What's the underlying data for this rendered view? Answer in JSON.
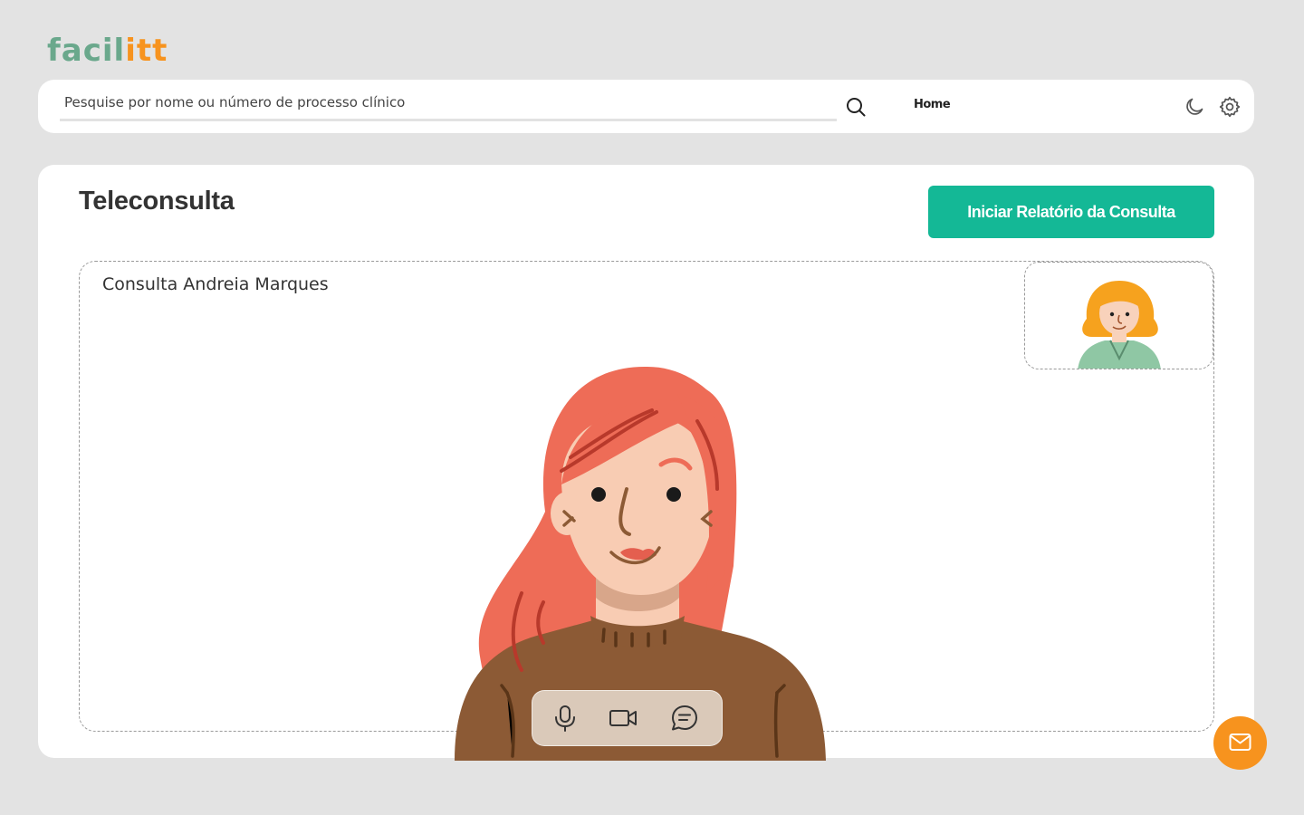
{
  "brand": {
    "logo_part1": "facil",
    "logo_part2": "itt",
    "colors": {
      "green": "#6aa88c",
      "orange": "#f7931e"
    }
  },
  "topbar": {
    "search": {
      "placeholder": "Pesquise por nome ou número de processo clínico",
      "value": ""
    },
    "search_icon": "search-icon",
    "nav": {
      "home_label": "Home"
    },
    "icons": [
      "moon-icon",
      "gear-icon"
    ]
  },
  "main": {
    "title": "Teleconsulta",
    "report_button_label": "Iniciar Relatório da Consulta",
    "accent": "#14b896",
    "video": {
      "consult_label": "Consulta Andreia Marques",
      "controls": [
        "microphone-icon",
        "video-camera-icon",
        "chat-icon"
      ]
    }
  },
  "fab": {
    "icon": "mail-icon",
    "color": "#f7931e"
  }
}
